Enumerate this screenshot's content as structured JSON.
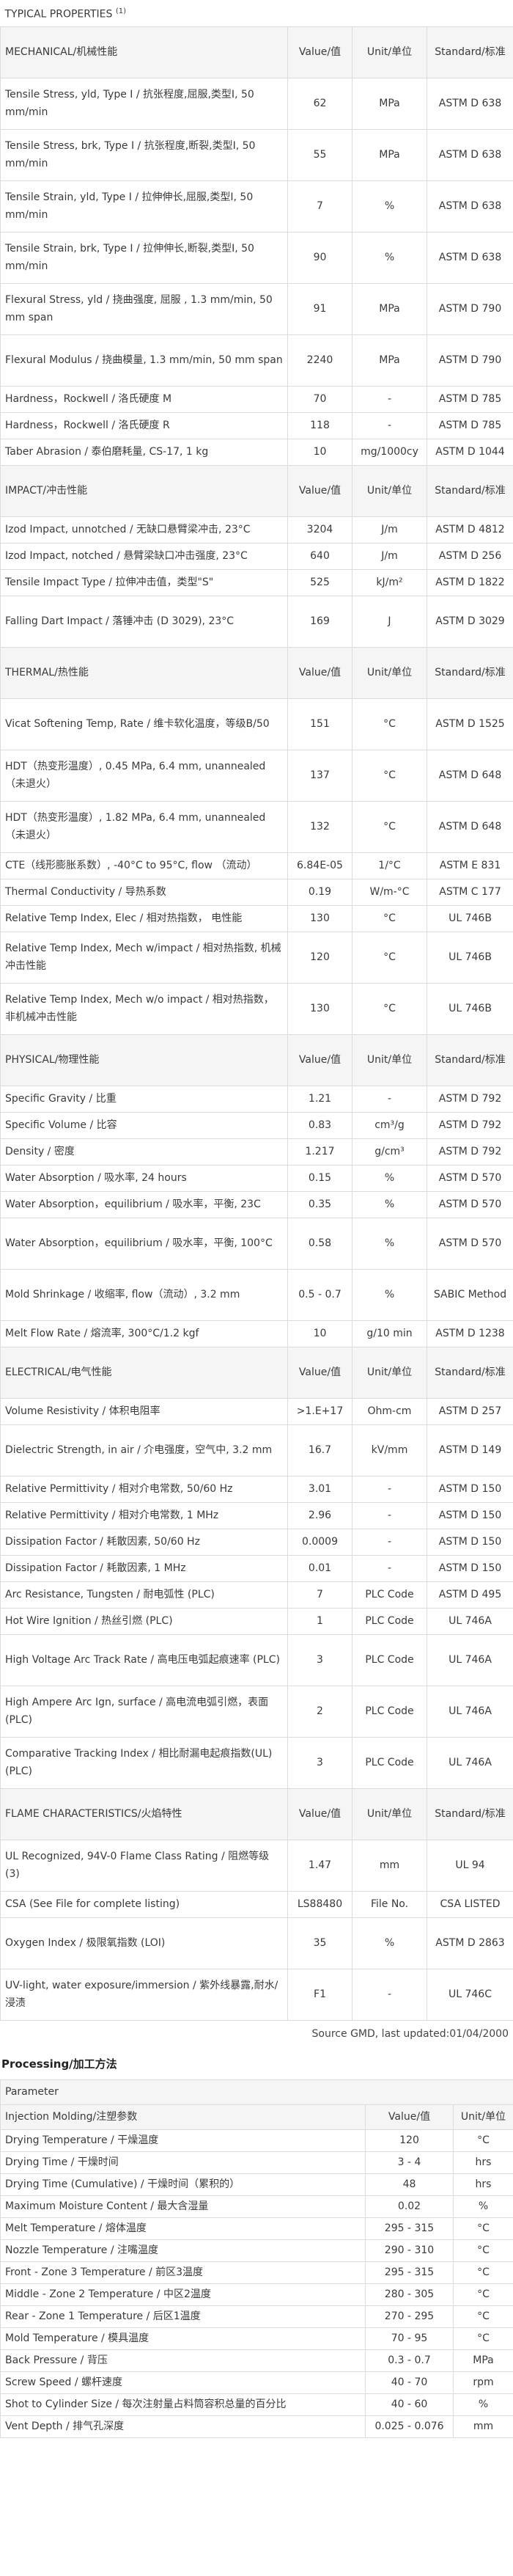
{
  "typical_title": "TYPICAL PROPERTIES",
  "typical_title_sup": "(1)",
  "sections": [
    {
      "name": "MECHANICAL/机械性能",
      "value_header": "Value/值",
      "unit_header": "Unit/单位",
      "std_header": "Standard/标准",
      "rows": [
        {
          "p": "Tensile Stress, yld, Type I / 抗张程度,屈服,类型I, 50 mm/min",
          "v": "62",
          "u": "MPa",
          "s": "ASTM D 638",
          "h": 2
        },
        {
          "p": "Tensile Stress, brk, Type I / 抗张程度,断裂,类型I, 50 mm/min",
          "v": "55",
          "u": "MPa",
          "s": "ASTM D 638",
          "h": 2
        },
        {
          "p": "Tensile Strain, yld, Type I / 拉伸伸长,屈服,类型I, 50 mm/min",
          "v": "7",
          "u": "%",
          "s": "ASTM D 638",
          "h": 2
        },
        {
          "p": "Tensile Strain, brk, Type I / 拉伸伸长,断裂,类型I, 50 mm/min",
          "v": "90",
          "u": "%",
          "s": "ASTM D 638",
          "h": 2
        },
        {
          "p": "Flexural Stress, yld / 挠曲强度, 屈服 , 1.3 mm/min, 50 mm span",
          "v": "91",
          "u": "MPa",
          "s": "ASTM D 790",
          "h": 2
        },
        {
          "p": "Flexural Modulus / 挠曲模量, 1.3 mm/min, 50 mm span",
          "v": "2240",
          "u": "MPa",
          "s": "ASTM D 790",
          "h": 2
        },
        {
          "p": "Hardness，Rockwell / 洛氏硬度 M",
          "v": "70",
          "u": "-",
          "s": "ASTM D 785",
          "h": 1
        },
        {
          "p": "Hardness，Rockwell / 洛氏硬度 R",
          "v": "118",
          "u": "-",
          "s": "ASTM D 785",
          "h": 1
        },
        {
          "p": "Taber Abrasion / 泰伯磨耗量, CS-17, 1 kg",
          "v": "10",
          "u": "mg/1000cy",
          "s": "ASTM D 1044",
          "h": 1
        }
      ]
    },
    {
      "name": "IMPACT/冲击性能",
      "value_header": "Value/值",
      "unit_header": "Unit/单位",
      "std_header": "Standard/标准",
      "rows": [
        {
          "p": "Izod Impact, unnotched / 无缺口悬臂梁冲击, 23°C",
          "v": "3204",
          "u": "J/m",
          "s": "ASTM D 4812",
          "h": 1
        },
        {
          "p": "Izod Impact, notched / 悬臂梁缺口冲击强度, 23°C",
          "v": "640",
          "u": "J/m",
          "s": "ASTM D 256",
          "h": 1
        },
        {
          "p": "Tensile Impact Type / 拉伸冲击值，类型\"S\"",
          "v": "525",
          "u": "kJ/m²",
          "s": "ASTM D 1822",
          "h": 1
        },
        {
          "p": "Falling Dart Impact / 落锤冲击 (D 3029), 23°C",
          "v": "169",
          "u": "J",
          "s": "ASTM D 3029",
          "h": 2
        }
      ]
    },
    {
      "name": "THERMAL/热性能",
      "value_header": "Value/值",
      "unit_header": "Unit/单位",
      "std_header": "Standard/标准",
      "rows": [
        {
          "p": "Vicat Softening Temp, Rate / 维卡软化温度，等级B/50",
          "v": "151",
          "u": "°C",
          "s": "ASTM D 1525",
          "h": 2
        },
        {
          "p": "HDT（热变形温度）, 0.45 MPa, 6.4 mm, unannealed（未退火）",
          "v": "137",
          "u": "°C",
          "s": "ASTM D 648",
          "h": 2
        },
        {
          "p": "HDT（热变形温度）, 1.82 MPa, 6.4 mm, unannealed（未退火）",
          "v": "132",
          "u": "°C",
          "s": "ASTM D 648",
          "h": 2
        },
        {
          "p": "CTE（线形膨胀系数）, -40°C to 95°C, flow （流动）",
          "v": "6.84E-05",
          "u": "1/°C",
          "s": "ASTM E 831",
          "h": 1
        },
        {
          "p": "Thermal Conductivity / 导热系数",
          "v": "0.19",
          "u": "W/m-°C",
          "s": "ASTM C 177",
          "h": 1
        },
        {
          "p": "Relative Temp Index, Elec / 相对热指数， 电性能",
          "v": "130",
          "u": "°C",
          "s": "UL 746B",
          "h": 1
        },
        {
          "p": "Relative Temp Index, Mech w/impact / 相对热指数, 机械冲击性能",
          "v": "120",
          "u": "°C",
          "s": "UL 746B",
          "h": 2
        },
        {
          "p": "Relative Temp Index, Mech w/o impact / 相对热指数，非机械冲击性能",
          "v": "130",
          "u": "°C",
          "s": "UL 746B",
          "h": 2
        }
      ]
    },
    {
      "name": "PHYSICAL/物理性能",
      "value_header": "Value/值",
      "unit_header": "Unit/单位",
      "std_header": "Standard/标准",
      "rows": [
        {
          "p": "Specific Gravity / 比重",
          "v": "1.21",
          "u": "-",
          "s": "ASTM D 792",
          "h": 1
        },
        {
          "p": "Specific Volume / 比容",
          "v": "0.83",
          "u": "cm³/g",
          "s": "ASTM D 792",
          "h": 1
        },
        {
          "p": "Density / 密度",
          "v": "1.217",
          "u": "g/cm³",
          "s": "ASTM D 792",
          "h": 1
        },
        {
          "p": "Water Absorption / 吸水率, 24 hours",
          "v": "0.15",
          "u": "%",
          "s": "ASTM D 570",
          "h": 1
        },
        {
          "p": "Water Absorption，equilibrium / 吸水率，平衡, 23C",
          "v": "0.35",
          "u": "%",
          "s": "ASTM D 570",
          "h": 1
        },
        {
          "p": "Water Absorption，equilibrium / 吸水率，平衡, 100°C",
          "v": "0.58",
          "u": "%",
          "s": "ASTM D 570",
          "h": 2
        },
        {
          "p": "Mold Shrinkage / 收缩率, flow（流动）, 3.2 mm",
          "v": "0.5 - 0.7",
          "u": "%",
          "s": "SABIC Method",
          "h": 2
        },
        {
          "p": "Melt Flow Rate / 熔流率, 300°C/1.2 kgf",
          "v": "10",
          "u": "g/10 min",
          "s": "ASTM D 1238",
          "h": 1
        }
      ]
    },
    {
      "name": "ELECTRICAL/电气性能",
      "value_header": "Value/值",
      "unit_header": "Unit/单位",
      "std_header": "Standard/标准",
      "rows": [
        {
          "p": "Volume Resistivity / 体积电阻率",
          "v": ">1.E+17",
          "u": "Ohm-cm",
          "s": "ASTM D 257",
          "h": 1
        },
        {
          "p": "Dielectric Strength, in air / 介电强度，空气中, 3.2 mm",
          "v": "16.7",
          "u": "kV/mm",
          "s": "ASTM D 149",
          "h": 2
        },
        {
          "p": "Relative Permittivity / 相对介电常数, 50/60 Hz",
          "v": "3.01",
          "u": "-",
          "s": "ASTM D 150",
          "h": 1
        },
        {
          "p": "Relative Permittivity / 相对介电常数, 1 MHz",
          "v": "2.96",
          "u": "-",
          "s": "ASTM D 150",
          "h": 1
        },
        {
          "p": "Dissipation Factor / 耗散因素, 50/60 Hz",
          "v": "0.0009",
          "u": "-",
          "s": "ASTM D 150",
          "h": 1
        },
        {
          "p": "Dissipation Factor / 耗散因素, 1 MHz",
          "v": "0.01",
          "u": "-",
          "s": "ASTM D 150",
          "h": 1
        },
        {
          "p": "Arc Resistance, Tungsten / 耐电弧性 (PLC)",
          "v": "7",
          "u": "PLC Code",
          "s": "ASTM D 495",
          "h": 1
        },
        {
          "p": "Hot Wire Ignition / 热丝引燃 (PLC)",
          "v": "1",
          "u": "PLC Code",
          "s": "UL 746A",
          "h": 1
        },
        {
          "p": "High Voltage Arc Track Rate / 高电压电弧起痕速率 (PLC)",
          "v": "3",
          "u": "PLC Code",
          "s": "UL 746A",
          "h": 2
        },
        {
          "p": "High Ampere Arc Ign, surface / 高电流电弧引燃，表面 (PLC)",
          "v": "2",
          "u": "PLC Code",
          "s": "UL 746A",
          "h": 2
        },
        {
          "p": "Comparative Tracking Index / 相比耐漏电起痕指数(UL) (PLC)",
          "v": "3",
          "u": "PLC Code",
          "s": "UL 746A",
          "h": 2
        }
      ]
    },
    {
      "name": "FLAME CHARACTERISTICS/火焰特性",
      "value_header": "Value/值",
      "unit_header": "Unit/单位",
      "std_header": "Standard/标准",
      "rows": [
        {
          "p": "UL Recognized, 94V-0 Flame Class Rating / 阻燃等级 (3)",
          "v": "1.47",
          "u": "mm",
          "s": "UL 94",
          "h": 2
        },
        {
          "p": "CSA (See File for complete listing)",
          "v": "LS88480",
          "u": "File No.",
          "s": "CSA LISTED",
          "h": 1
        },
        {
          "p": "Oxygen Index / 极限氧指数 (LOI)",
          "v": "35",
          "u": "%",
          "s": "ASTM D 2863",
          "h": 2
        },
        {
          "p": "UV-light, water exposure/immersion / 紫外线暴露,耐水/浸渍",
          "v": "F1",
          "u": "-",
          "s": "UL 746C",
          "h": 2
        }
      ]
    }
  ],
  "footer": "Source GMD, last updated:01/04/2000",
  "processing": {
    "title": "Processing/加工方法",
    "parameter_label": "Parameter",
    "section_name": "Injection Molding/注塑参数",
    "value_header": "Value/值",
    "unit_header": "Unit/单位",
    "rows": [
      {
        "p": "Drying Temperature / 干燥温度",
        "v": "120",
        "u": "°C"
      },
      {
        "p": "Drying Time / 干燥时间",
        "v": "3 - 4",
        "u": "hrs"
      },
      {
        "p": "Drying Time (Cumulative) / 干燥时间（累积的）",
        "v": "48",
        "u": "hrs"
      },
      {
        "p": "Maximum Moisture Content / 最大含湿量",
        "v": "0.02",
        "u": "%"
      },
      {
        "p": "Melt Temperature / 熔体温度",
        "v": "295 - 315",
        "u": "°C"
      },
      {
        "p": "Nozzle Temperature / 注嘴温度",
        "v": "290 - 310",
        "u": "°C"
      },
      {
        "p": "Front - Zone 3 Temperature / 前区3温度",
        "v": "295 - 315",
        "u": "°C"
      },
      {
        "p": "Middle - Zone 2 Temperature / 中区2温度",
        "v": "280 - 305",
        "u": "°C"
      },
      {
        "p": "Rear - Zone 1 Temperature / 后区1温度",
        "v": "270 - 295",
        "u": "°C"
      },
      {
        "p": "Mold Temperature / 模具温度",
        "v": "70 - 95",
        "u": "°C"
      },
      {
        "p": "Back Pressure / 背压",
        "v": "0.3 - 0.7",
        "u": "MPa"
      },
      {
        "p": "Screw Speed / 螺杆速度",
        "v": "40 - 70",
        "u": "rpm"
      },
      {
        "p": "Shot to Cylinder Size / 每次注射量占料筒容积总量的百分比",
        "v": "40 - 60",
        "u": "%"
      },
      {
        "p": "Vent Depth / 排气孔深度",
        "v": "0.025 - 0.076",
        "u": "mm"
      }
    ]
  }
}
